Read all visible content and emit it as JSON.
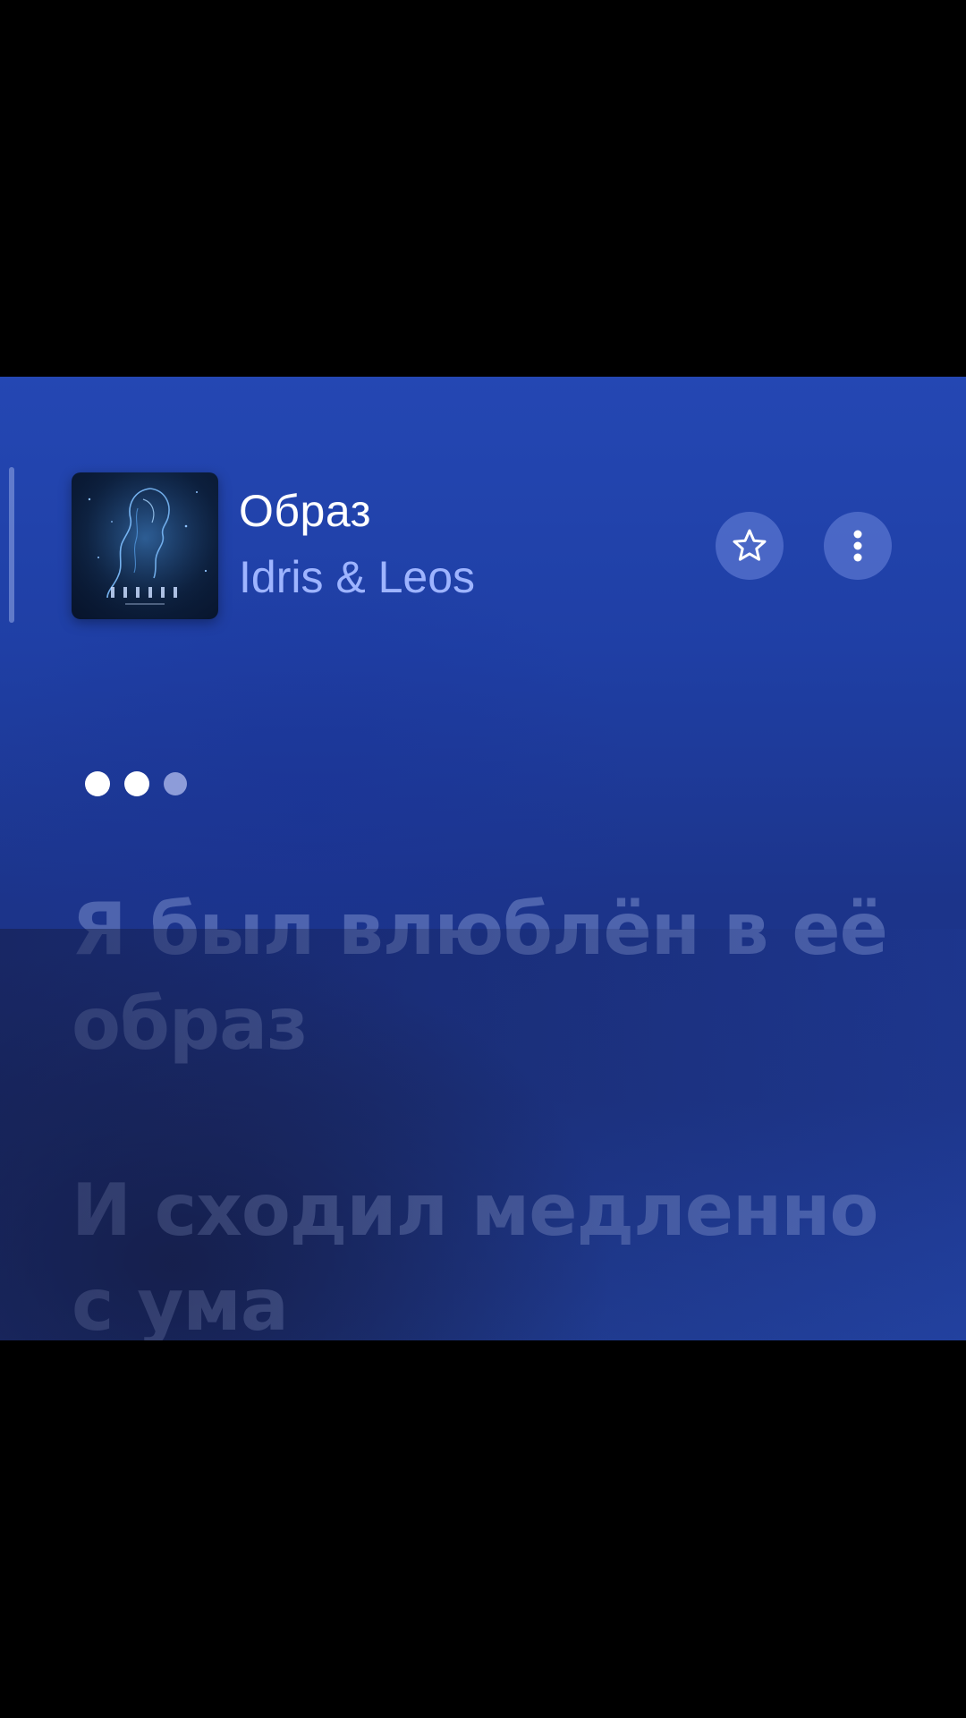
{
  "track": {
    "title": "Образ",
    "artist": "Idris & Leos",
    "cover_icon": "album-cover-woman-silhouette",
    "cover_caption": "ОБРАЗ"
  },
  "actions": {
    "favorite_icon": "star-icon",
    "more_icon": "more-vertical-icon"
  },
  "intro_indicator": {
    "dots": 3
  },
  "lyrics": [
    "Я был влюблён в её образ",
    "И сходил медленно с ума"
  ],
  "colors": {
    "background": "#000000",
    "panel_top": "#2447b3",
    "panel_bottom": "#1d3589",
    "artist_text": "#9eb4ff",
    "button_fill": "#6e87dc",
    "lyric_dim": "#aab9eb"
  }
}
